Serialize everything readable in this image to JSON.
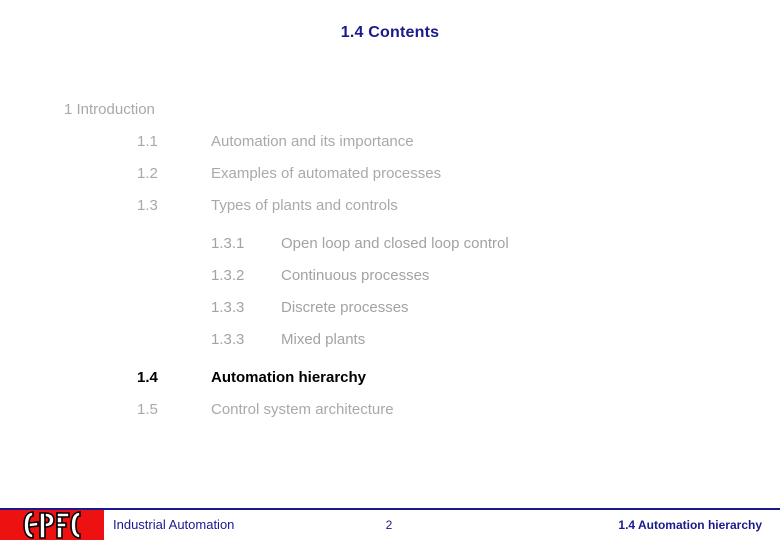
{
  "slide": {
    "title": "1.4 Contents",
    "title_color": "#1a1a8c",
    "background_color": "#ffffff"
  },
  "contents": {
    "heading": "1 Introduction",
    "items": [
      {
        "number": "1.1",
        "label": "Automation and its importance",
        "level": 1,
        "state": "normal"
      },
      {
        "number": "1.2",
        "label": "Examples of automated processes",
        "level": 1,
        "state": "normal"
      },
      {
        "number": "1.3",
        "label": "Types of plants and controls",
        "level": 1,
        "state": "normal"
      },
      {
        "number": "1.3.1",
        "label": "Open loop and closed loop control",
        "level": 2,
        "state": "normal"
      },
      {
        "number": "1.3.2",
        "label": "Continuous processes",
        "level": 2,
        "state": "normal"
      },
      {
        "number": "1.3.3",
        "label": "Discrete processes",
        "level": 2,
        "state": "normal"
      },
      {
        "number": "1.3.3",
        "label": "Mixed plants",
        "level": 2,
        "state": "normal"
      },
      {
        "number": "1.4",
        "label": "Automation hierarchy",
        "level": 1,
        "state": "active"
      },
      {
        "number": "1.5",
        "label": "Control system architecture",
        "level": 1,
        "state": "normal"
      }
    ],
    "dim_color": "#a9a9a9",
    "active_color": "#000000"
  },
  "footer": {
    "logo_text": "EPFL",
    "logo_background": "#ee1111",
    "course": "Industrial Automation",
    "page_number": "2",
    "section": "1.4 Automation hierarchy",
    "rule_color": "#1a1a8c"
  }
}
